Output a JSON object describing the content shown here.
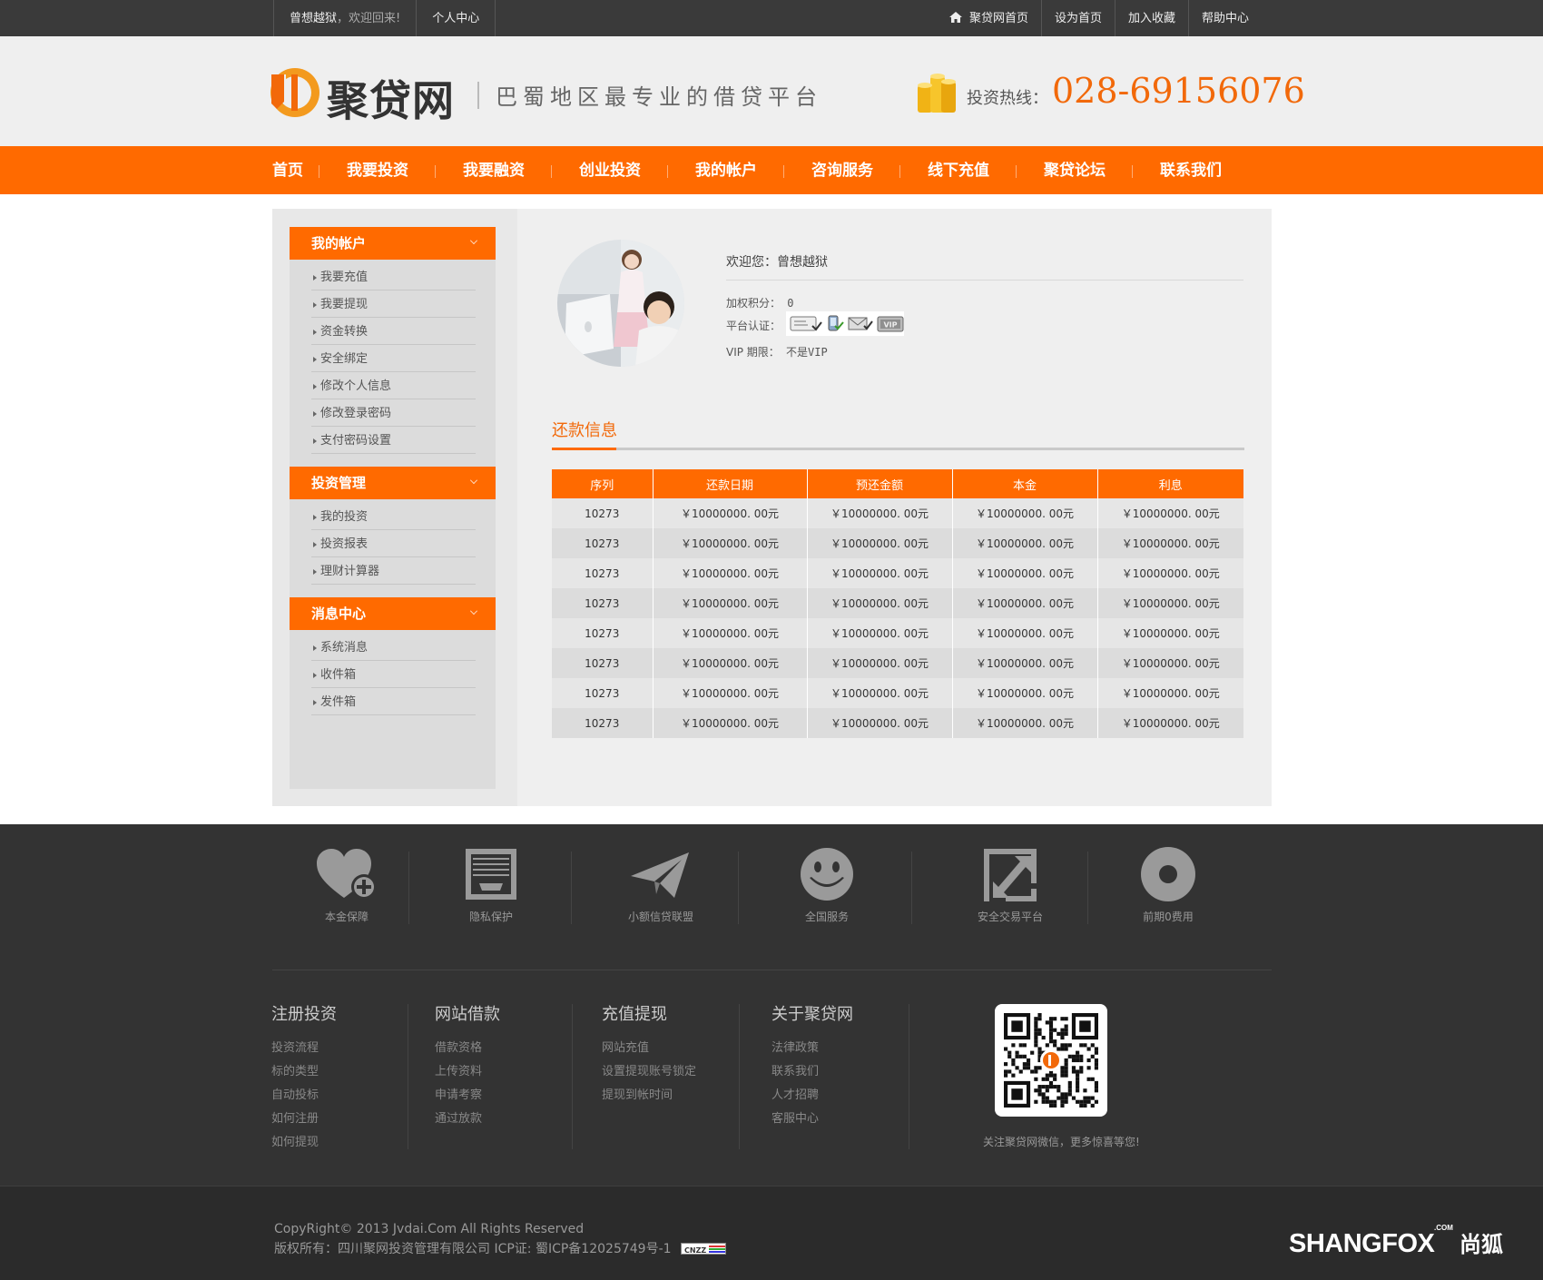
{
  "topbar": {
    "username": "曾想越狱",
    "welcome": "，欢迎回来!",
    "personal_center": "个人中心",
    "links": [
      "聚贷网首页",
      "设为首页",
      "加入收藏",
      "帮助中心"
    ]
  },
  "header": {
    "logo_text": "聚贷网",
    "slogan": "巴蜀地区最专业的借贷平台",
    "hotline_label": "投资热线：",
    "hotline_number": "028-69156076"
  },
  "nav": [
    "首页",
    "我要投资",
    "我要融资",
    "创业投资",
    "我的帐户",
    "咨询服务",
    "线下充值",
    "聚贷论坛",
    "联系我们"
  ],
  "sidebar": [
    {
      "title": "我的帐户",
      "items": [
        "我要充值",
        "我要提现",
        "资金转换",
        "安全绑定",
        "修改个人信息",
        "修改登录密码",
        "支付密码设置"
      ]
    },
    {
      "title": "投资管理",
      "items": [
        "我的投资",
        "投资报表",
        "理财计算器"
      ]
    },
    {
      "title": "消息中心",
      "items": [
        "系统消息",
        "收件箱",
        "发件箱"
      ]
    }
  ],
  "profile": {
    "welcome_label": "欢迎您：",
    "username": "曾想越狱",
    "points_label": "加权积分：",
    "points_value": "0",
    "cert_label": "平台认证：",
    "vip_label": "VIP 期限：",
    "vip_value": "不是VIP",
    "vip_badge": "VIP"
  },
  "repay": {
    "title": "还款信息",
    "columns": [
      "序列",
      "还款日期",
      "预还金额",
      "本金",
      "利息"
    ],
    "rows": [
      [
        "10273",
        "￥10000000. 00元",
        "￥10000000. 00元",
        "￥10000000. 00元",
        "￥10000000. 00元"
      ],
      [
        "10273",
        "￥10000000. 00元",
        "￥10000000. 00元",
        "￥10000000. 00元",
        "￥10000000. 00元"
      ],
      [
        "10273",
        "￥10000000. 00元",
        "￥10000000. 00元",
        "￥10000000. 00元",
        "￥10000000. 00元"
      ],
      [
        "10273",
        "￥10000000. 00元",
        "￥10000000. 00元",
        "￥10000000. 00元",
        "￥10000000. 00元"
      ],
      [
        "10273",
        "￥10000000. 00元",
        "￥10000000. 00元",
        "￥10000000. 00元",
        "￥10000000. 00元"
      ],
      [
        "10273",
        "￥10000000. 00元",
        "￥10000000. 00元",
        "￥10000000. 00元",
        "￥10000000. 00元"
      ],
      [
        "10273",
        "￥10000000. 00元",
        "￥10000000. 00元",
        "￥10000000. 00元",
        "￥10000000. 00元"
      ],
      [
        "10273",
        "￥10000000. 00元",
        "￥10000000. 00元",
        "￥10000000. 00元",
        "￥10000000. 00元"
      ]
    ]
  },
  "features": [
    {
      "icon": "heart-plus-icon",
      "label": "本金保障"
    },
    {
      "icon": "inbox-icon",
      "label": "隐私保护"
    },
    {
      "icon": "paper-plane-icon",
      "label": "小额信贷联盟"
    },
    {
      "icon": "smiley-icon",
      "label": "全国服务"
    },
    {
      "icon": "expand-arrows-icon",
      "label": "安全交易平台"
    },
    {
      "icon": "ring-icon",
      "label": "前期0费用"
    }
  ],
  "footer_columns": [
    {
      "title": "注册投资",
      "items": [
        "投资流程",
        "标的类型",
        "自动投标",
        "如何注册",
        "如何提现"
      ]
    },
    {
      "title": "网站借款",
      "items": [
        "借款资格",
        "上传资料",
        "申请考察",
        "通过放款"
      ]
    },
    {
      "title": "充值提现",
      "items": [
        "网站充值",
        "设置提现账号锁定",
        "提现到帐时间"
      ]
    },
    {
      "title": "关于聚贷网",
      "items": [
        "法律政策",
        "联系我们",
        "人才招聘",
        "客服中心"
      ]
    }
  ],
  "qr_caption": "关注聚贷网微信，更多惊喜等您!",
  "bottom": {
    "copyright": "CopyRight© 2013 Jvdai.Com All Rights Reserved",
    "owner": "版权所有：四川聚网投资管理有限公司 ICP证: 蜀ICP备12025749号-1",
    "cnzz": "CNZZ",
    "brand": "SHANGFOX",
    "brand_cn": "尚狐",
    "brand_sup": ".COM"
  },
  "colors": {
    "accent": "#ff6a00",
    "hotline": "#f2690a",
    "footer_bg": "#333333"
  }
}
